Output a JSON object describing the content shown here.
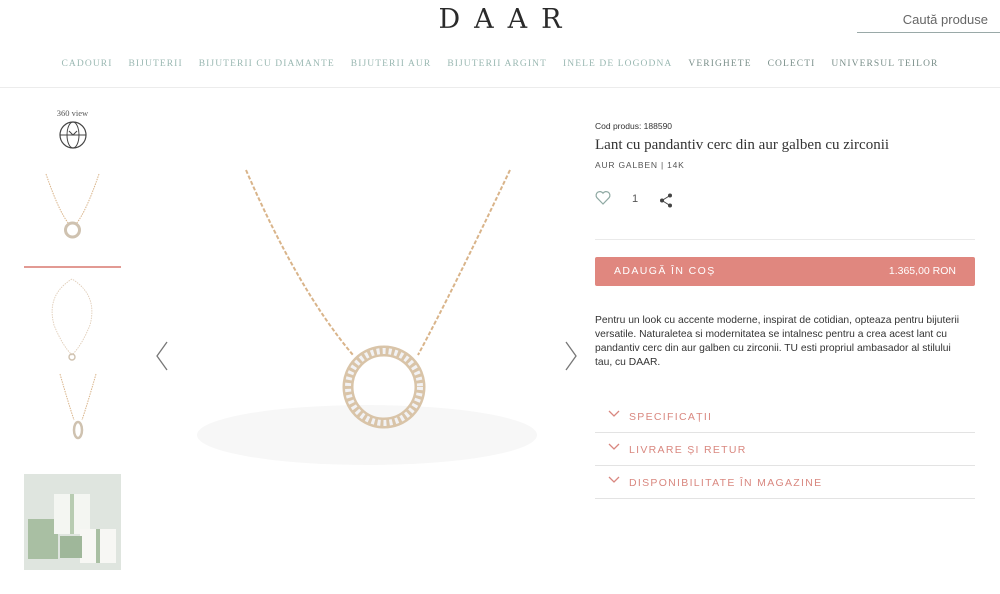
{
  "header": {
    "logo": "DAAR",
    "search_placeholder": "Caută produse"
  },
  "nav": [
    {
      "label": "Cadouri"
    },
    {
      "label": "Bijuterii"
    },
    {
      "label": "Bijuterii cu diamante"
    },
    {
      "label": "Bijuterii aur"
    },
    {
      "label": "Bijuterii argint"
    },
    {
      "label": "Inele de logodna"
    },
    {
      "label": "Verighete"
    },
    {
      "label": "Colecti"
    },
    {
      "label": "Universul teilor"
    }
  ],
  "gallery": {
    "view360_label": "360 view"
  },
  "product": {
    "code": "Cod produs: 188590",
    "title": "Lant cu pandantiv cerc din aur galben cu zirconii",
    "subtitle": "AUR GALBEN | 14K",
    "quantity": "1",
    "add_to_cart_label": "ADAUGĂ ÎN COȘ",
    "price": "1.365,00 RON",
    "description": "Pentru un look cu accente moderne, inspirat de cotidian, opteaza pentru bijuterii versatile. Naturaletea si modernitatea se intalnesc pentru a crea acest lant cu pandantiv cerc din aur galben cu zirconii. TU esti propriul ambasador al stilului tau, cu DAAR."
  },
  "accordion": [
    {
      "label": "SPECIFICAȚII"
    },
    {
      "label": "LIVRARE ȘI RETUR"
    },
    {
      "label": "DISPONIBILITATE ÎN MAGAZINE"
    }
  ],
  "colors": {
    "accent": "#e0877f",
    "nav_text": "#9ab8b2",
    "gold": "#d9b48a"
  }
}
